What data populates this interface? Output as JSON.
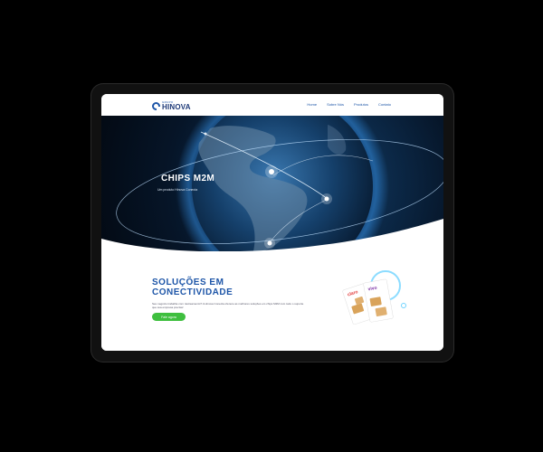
{
  "nav": {
    "logo_small": "GRUPO",
    "logo_big": "HINOVA",
    "menu": [
      "Home",
      "Sobre Nós",
      "Produtos",
      "Contato"
    ]
  },
  "hero": {
    "title": "CHIPS M2M",
    "subtitle": "Um produto Hinova Conecta"
  },
  "section": {
    "title_line1": "SOLUÇÕES EM",
    "title_line2": "CONECTIVIDADE",
    "text": "Seu negócio trabalha com rastreamento? A Hinova Conecta oferece as melhores soluções em chips M2M com todo o suporte que sua empresa precisa!",
    "cta": "Fale agora"
  },
  "colors": {
    "brand_blue": "#1e56a8",
    "cta_green": "#3fbf3f",
    "hero_dark": "#061528"
  },
  "icons": [
    "logo-icon",
    "sim-chip-icon"
  ]
}
